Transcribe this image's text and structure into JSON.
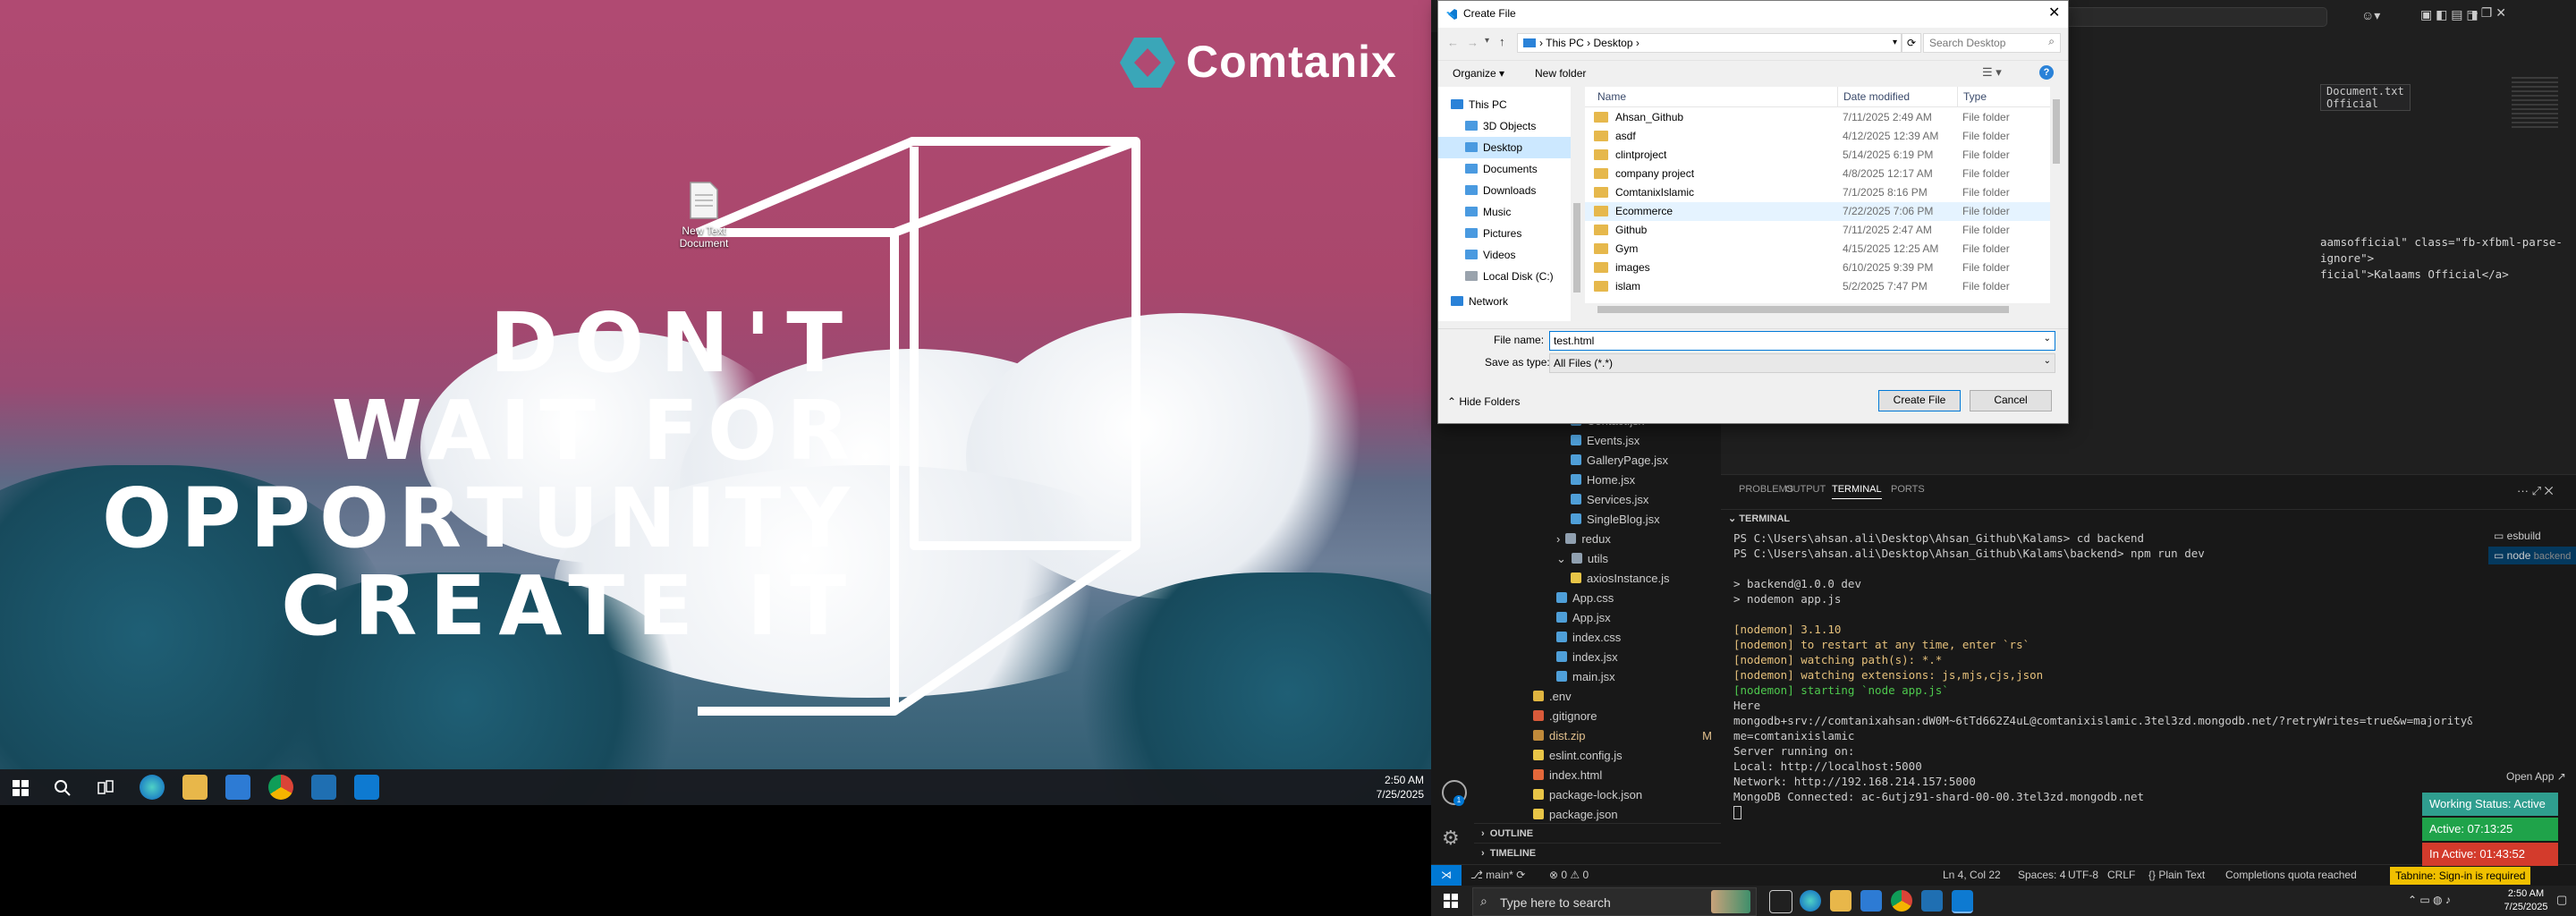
{
  "desktop": {
    "logo_text": "Comtanix",
    "quote_lines": [
      "DON'T",
      "WAIT FOR",
      "OPPORTUNITY",
      "CREATE IT"
    ],
    "desktop_icon_label": "New Text Document",
    "clock_time": "2:50 AM",
    "clock_date": "7/25/2025"
  },
  "dialog": {
    "title": "Create File",
    "breadcrumb": [
      "This PC",
      "Desktop"
    ],
    "search_placeholder": "Search Desktop",
    "organize_label": "Organize ▾",
    "new_folder_label": "New folder",
    "nav_items": [
      "This PC",
      "3D Objects",
      "Desktop",
      "Documents",
      "Downloads",
      "Music",
      "Pictures",
      "Videos",
      "Local Disk (C:)",
      "Network"
    ],
    "columns": {
      "name": "Name",
      "date": "Date modified",
      "type": "Type"
    },
    "files": [
      {
        "name": "Ahsan_Github",
        "date": "7/11/2025 2:49 AM",
        "type": "File folder"
      },
      {
        "name": "asdf",
        "date": "4/12/2025 12:39 AM",
        "type": "File folder"
      },
      {
        "name": "clintproject",
        "date": "5/14/2025 6:19 PM",
        "type": "File folder"
      },
      {
        "name": "company project",
        "date": "4/8/2025 12:17 AM",
        "type": "File folder"
      },
      {
        "name": "ComtanixIslamic",
        "date": "7/1/2025 8:16 PM",
        "type": "File folder"
      },
      {
        "name": "Ecommerce",
        "date": "7/22/2025 7:06 PM",
        "type": "File folder"
      },
      {
        "name": "Github",
        "date": "7/11/2025 2:47 AM",
        "type": "File folder"
      },
      {
        "name": "Gym",
        "date": "4/15/2025 12:25 AM",
        "type": "File folder"
      },
      {
        "name": "images",
        "date": "6/10/2025 9:39 PM",
        "type": "File folder"
      },
      {
        "name": "islam",
        "date": "5/2/2025 7:47 PM",
        "type": "File folder"
      }
    ],
    "file_name_label": "File name:",
    "file_name_value": "test.html",
    "save_type_label": "Save as type:",
    "save_type_value": "All Files (*.*)",
    "hide_folders_label": "Hide Folders",
    "create_button": "Create File",
    "cancel_button": "Cancel"
  },
  "editor": {
    "snippet_tab": "Document.txt",
    "snippet_tab_sub": "Official",
    "code_lines": [
      "aamsofficial\" class=\"fb-xfbml-parse-ignore\">",
      "ficial\">Kalaams Official</a>"
    ]
  },
  "explorer": {
    "items": [
      {
        "label": "Contact.jsx",
        "kind": "jsx",
        "indent": 1
      },
      {
        "label": "Events.jsx",
        "kind": "jsx",
        "indent": 1
      },
      {
        "label": "GalleryPage.jsx",
        "kind": "jsx",
        "indent": 1
      },
      {
        "label": "Home.jsx",
        "kind": "jsx",
        "indent": 1
      },
      {
        "label": "Services.jsx",
        "kind": "jsx",
        "indent": 1
      },
      {
        "label": "SingleBlog.jsx",
        "kind": "jsx",
        "indent": 1
      },
      {
        "label": "redux",
        "kind": "folder",
        "indent": 0
      },
      {
        "label": "utils",
        "kind": "folder-open",
        "indent": 0
      },
      {
        "label": "axiosInstance.js",
        "kind": "js",
        "indent": 1
      },
      {
        "label": "App.css",
        "kind": "css",
        "indent": 0
      },
      {
        "label": "App.jsx",
        "kind": "jsx",
        "indent": 0
      },
      {
        "label": "index.css",
        "kind": "css",
        "indent": 0
      },
      {
        "label": "index.jsx",
        "kind": "jsx",
        "indent": 0
      },
      {
        "label": "main.jsx",
        "kind": "jsx",
        "indent": 0
      },
      {
        "label": ".env",
        "kind": "env",
        "indent": -1
      },
      {
        "label": ".gitignore",
        "kind": "git",
        "indent": -1
      },
      {
        "label": "dist.zip",
        "kind": "zip",
        "indent": -1,
        "badge": "M"
      },
      {
        "label": "eslint.config.js",
        "kind": "js",
        "indent": -1
      },
      {
        "label": "index.html",
        "kind": "html",
        "indent": -1
      },
      {
        "label": "package-lock.json",
        "kind": "json",
        "indent": -1
      },
      {
        "label": "package.json",
        "kind": "json",
        "indent": -1
      }
    ],
    "outline_label": "OUTLINE",
    "timeline_label": "TIMELINE"
  },
  "panel": {
    "tabs": [
      "PROBLEMS",
      "OUTPUT",
      "TERMINAL",
      "PORTS"
    ],
    "active_tab": "TERMINAL",
    "terminal_header": "TERMINAL",
    "lines": [
      {
        "text": "PS C:\\Users\\ahsan.ali\\Desktop\\Ahsan_Github\\Kalams> cd backend",
        "color": "#cccccc"
      },
      {
        "text": "PS C:\\Users\\ahsan.ali\\Desktop\\Ahsan_Github\\Kalams\\backend> npm run dev",
        "color": "#cccccc"
      },
      {
        "text": "",
        "color": "#cccccc"
      },
      {
        "text": "> backend@1.0.0 dev",
        "color": "#cccccc"
      },
      {
        "text": "> nodemon app.js",
        "color": "#cccccc"
      },
      {
        "text": "",
        "color": "#cccccc"
      },
      {
        "text": "[nodemon] 3.1.10",
        "color": "#e5c07b"
      },
      {
        "text": "[nodemon] to restart at any time, enter `rs`",
        "color": "#e5c07b"
      },
      {
        "text": "[nodemon] watching path(s): *.*",
        "color": "#e5c07b"
      },
      {
        "text": "[nodemon] watching extensions: js,mjs,cjs,json",
        "color": "#e5c07b"
      },
      {
        "text": "[nodemon] starting `node app.js`",
        "color": "#4ec94e"
      },
      {
        "text": "Here",
        "color": "#cccccc"
      },
      {
        "text": "mongodb+srv://comtanixahsan:dW0M~6tTd662Z4uL@comtanixislamic.3tel3zd.mongodb.net/?retryWrites=true&w=majority&appNa",
        "color": "#cccccc"
      },
      {
        "text": "me=comtanixislamic",
        "color": "#cccccc"
      },
      {
        "text": "Server running on:",
        "color": "#cccccc"
      },
      {
        "text": "  Local: http://localhost:5000",
        "color": "#cccccc"
      },
      {
        "text": "  Network: http://192.168.214.157:5000",
        "color": "#cccccc"
      },
      {
        "text": "MongoDB Connected: ac-6utjz91-shard-00-00.3tel3zd.mongodb.net",
        "color": "#cccccc"
      }
    ],
    "term_list": [
      {
        "name": "esbuild",
        "sub": "frontend"
      },
      {
        "name": "node",
        "sub": "backend"
      }
    ],
    "open_app": "Open App ↗"
  },
  "status_badges": [
    {
      "text": "Working Status: Active",
      "color": "#2f9e8f"
    },
    {
      "text": "Active: 07:13:25",
      "color": "#1fa34a"
    },
    {
      "text": "In Active: 01:43:52",
      "color": "#d33b2c"
    }
  ],
  "statusbar": {
    "branch": "main*",
    "problems": "⊗ 0 ⚠ 0",
    "position": "Ln 4, Col 22",
    "spaces": "Spaces: 4",
    "encoding": "UTF-8",
    "eol": "CRLF",
    "lang": "{} Plain Text",
    "quota": "Completions quota reached",
    "tabnine": "Tabnine: Sign-in is required"
  },
  "taskbar_right": {
    "search_placeholder": "Type here to search",
    "time": "2:50 AM",
    "date": "7/25/2025"
  },
  "colors": {
    "accent": "#007acc",
    "vscode_bg": "#1e1e1e",
    "folder": "#e6b84c"
  }
}
